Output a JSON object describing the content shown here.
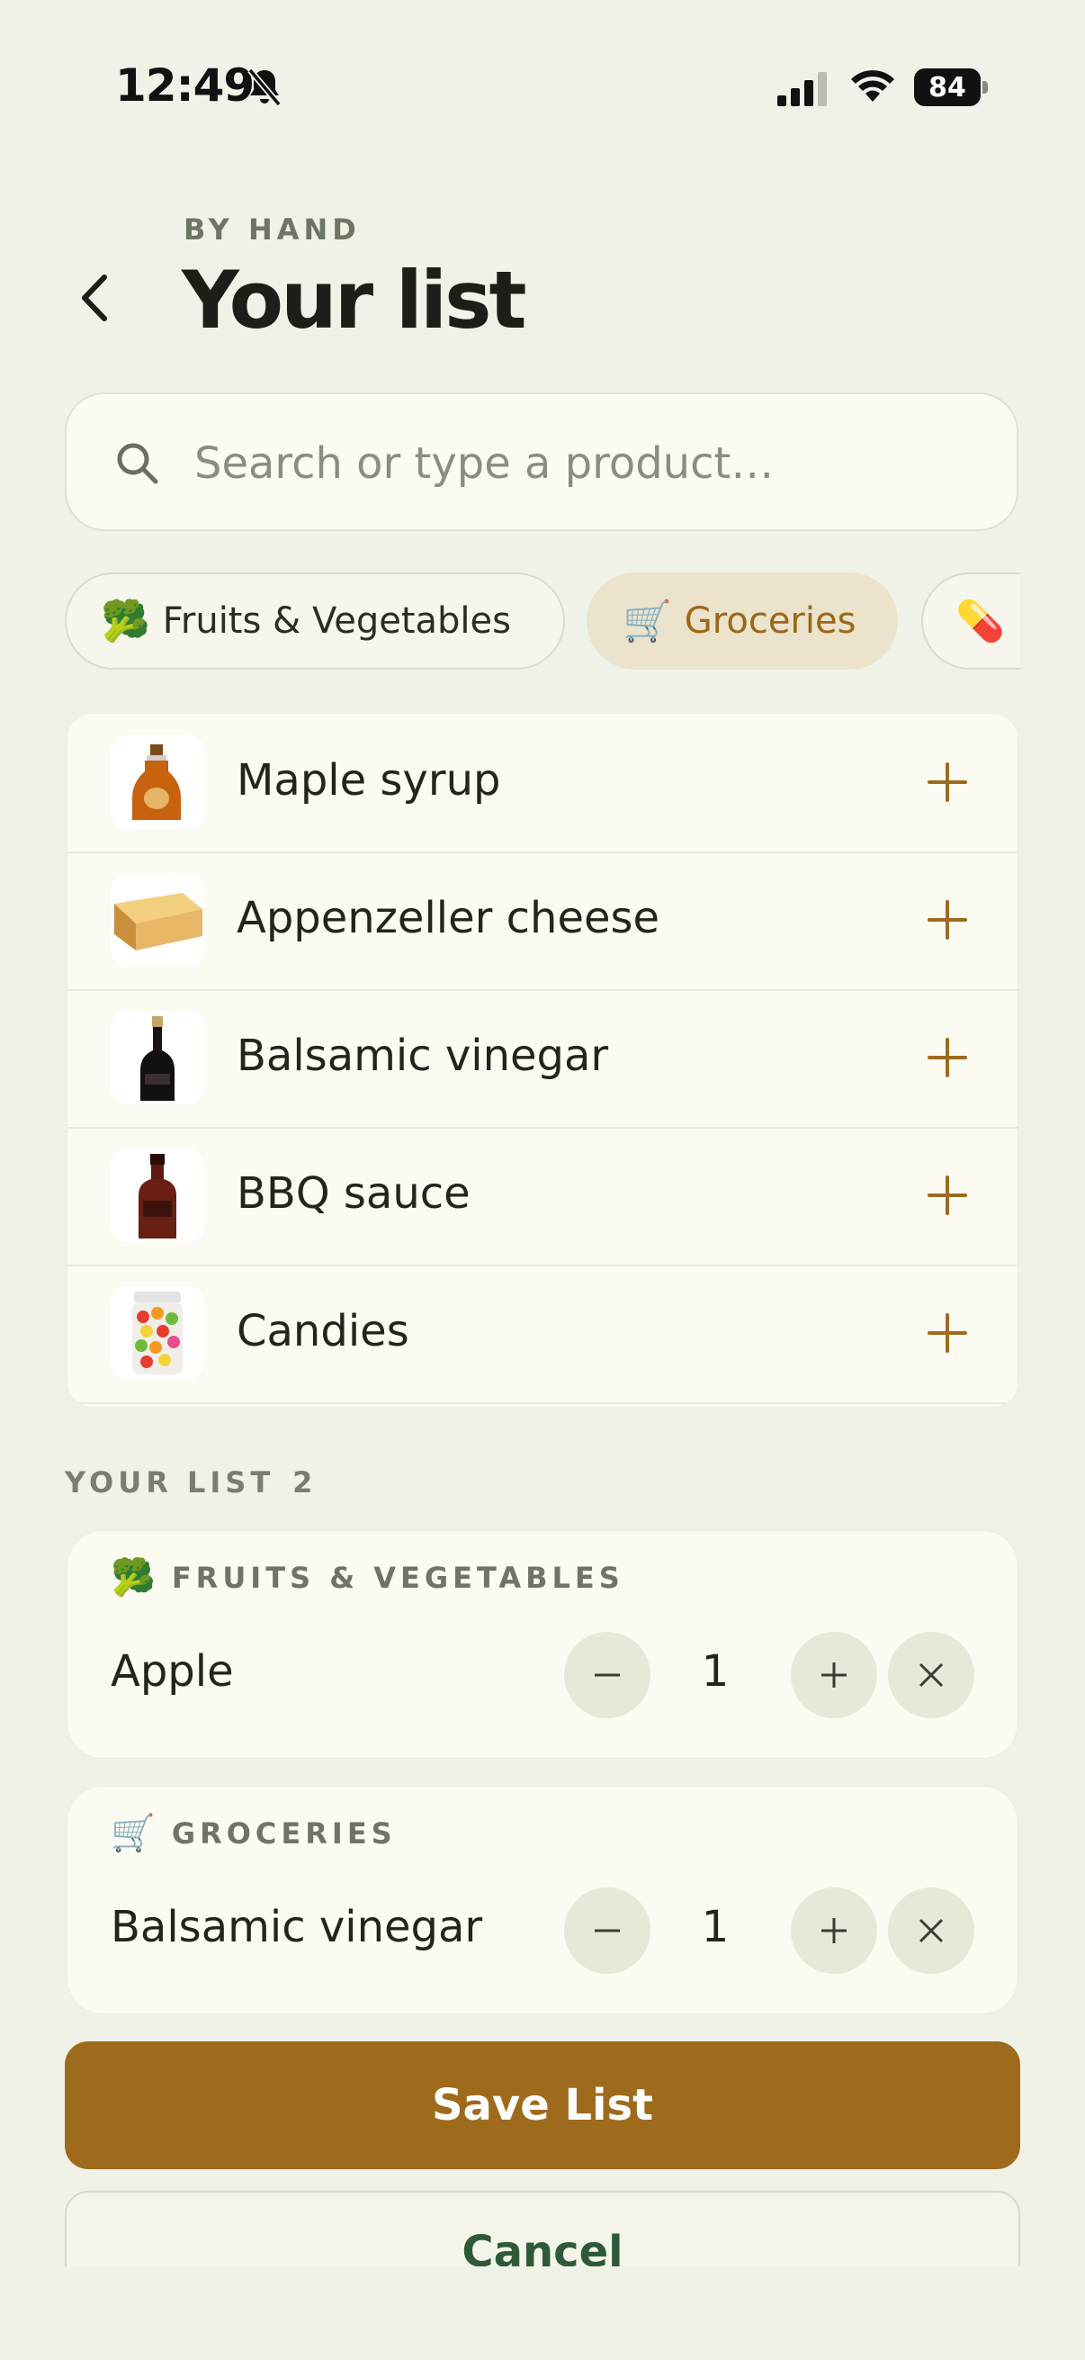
{
  "status_bar": {
    "time": "12:49",
    "battery": "84",
    "icons": [
      "bell-slash-icon",
      "cellular-signal-icon",
      "wifi-icon",
      "battery-icon"
    ]
  },
  "header": {
    "eyebrow": "BY HAND",
    "title": "Your list",
    "back_icon": "chevron-left-icon"
  },
  "search": {
    "placeholder": "Search or type a product…",
    "value": "",
    "icon": "search-icon"
  },
  "categories": [
    {
      "emoji": "🥦",
      "label": "Fruits & Vegetables",
      "active": false
    },
    {
      "emoji": "🛒",
      "label": "Groceries",
      "active": true
    },
    {
      "emoji": "💊",
      "label": "",
      "active": false
    }
  ],
  "products": [
    {
      "name": "Maple syrup",
      "image": "maple-syrup-bottle"
    },
    {
      "name": "Appenzeller cheese",
      "image": "cheese-wedge"
    },
    {
      "name": "Balsamic vinegar",
      "image": "vinegar-bottle"
    },
    {
      "name": "BBQ sauce",
      "image": "bbq-sauce-bottle"
    },
    {
      "name": "Candies",
      "image": "candy-jar"
    }
  ],
  "your_list": {
    "label": "YOUR LIST",
    "count": "2",
    "groups": [
      {
        "emoji": "🥦",
        "category": "FRUITS & VEGETABLES",
        "item": "Apple",
        "quantity": "1"
      },
      {
        "emoji": "🛒",
        "category": "GROCERIES",
        "item": "Balsamic vinegar",
        "quantity": "1"
      }
    ]
  },
  "actions": {
    "save": "Save List",
    "cancel": "Cancel"
  },
  "colors": {
    "background": "#f1f2e7",
    "accent": "#9e6a1c",
    "cancel_text": "#2f5a3a"
  }
}
